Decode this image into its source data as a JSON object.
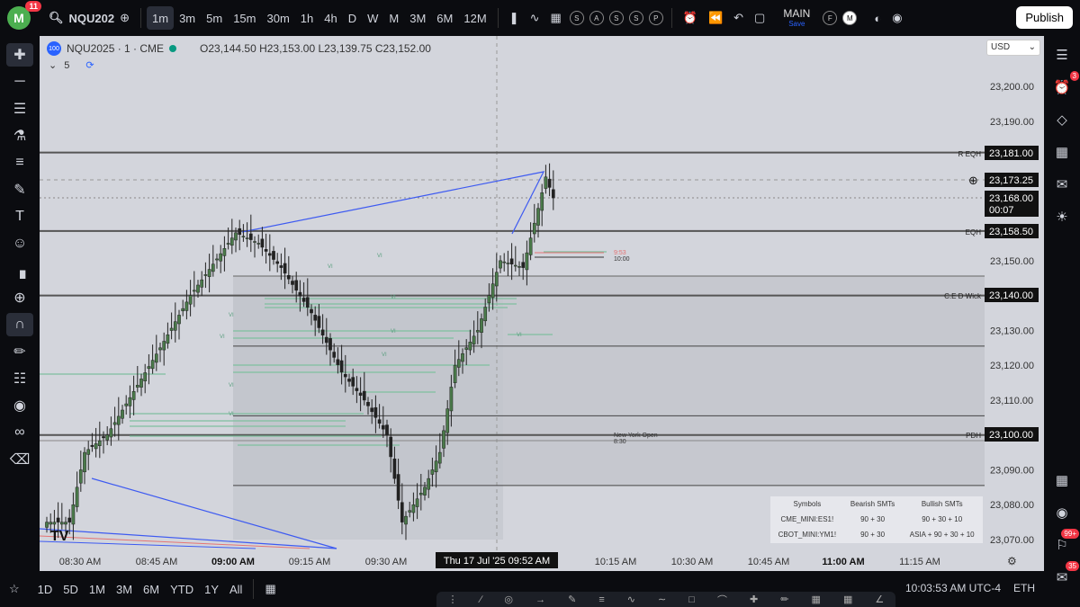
{
  "topbar": {
    "logo_letter": "M",
    "logo_badge": "11",
    "symbol": "NQU202",
    "timeframes": [
      "1m",
      "3m",
      "5m",
      "15m",
      "30m",
      "1h",
      "4h",
      "D",
      "W",
      "M",
      "3M",
      "6M",
      "12M"
    ],
    "active_timeframe": "1m",
    "circle_buttons": [
      "S",
      "A",
      "S",
      "S",
      "P"
    ],
    "layout_name": "MAIN",
    "layout_save": "Save",
    "profile_f": "F",
    "profile_m": "M",
    "publish": "Publish"
  },
  "legend": {
    "badge": "100",
    "title": "NQU2025 · 1 · CME",
    "ohlc": "O23,144.50 H23,153.00 L23,139.75 C23,152.00",
    "indicator_count": "5"
  },
  "currency": "USD",
  "price_axis": {
    "ticks": [
      "23,200.00",
      "23,190.00",
      "23,150.00",
      "23,130.00",
      "23,120.00",
      "23,110.00",
      "23,090.00",
      "23,080.00",
      "23,070.00"
    ],
    "labels": [
      {
        "text": "23,181.00",
        "name": "R EQH"
      },
      {
        "text": "23,173.25",
        "name": ""
      },
      {
        "text": "23,168.00",
        "name": ""
      },
      {
        "text": "00:07",
        "name": ""
      },
      {
        "text": "23,158.50",
        "name": "EQH"
      },
      {
        "text": "23,140.00",
        "name": "C.E D Wick"
      },
      {
        "text": "23,100.00",
        "name": "PDH"
      }
    ]
  },
  "time_axis": {
    "ticks": [
      "08:30 AM",
      "08:45 AM",
      "09:00 AM",
      "09:15 AM",
      "09:30 AM",
      "10:15 AM",
      "10:30 AM",
      "10:45 AM",
      "11:00 AM",
      "11:15 AM"
    ],
    "crosshair": "Thu 17 Jul '25   09:52 AM"
  },
  "annotations": {
    "ny_open": "New York Open",
    "ny_open_time": "8:30",
    "t953": "9:53",
    "t1000": "10:00",
    "vi": "VI"
  },
  "smt_table": {
    "headers": [
      "Symbols",
      "Bearish SMTs",
      "Bullish SMTs"
    ],
    "rows": [
      [
        "CME_MINI:ES1!",
        "90 + 30",
        "90 + 30 + 10"
      ],
      [
        "CBOT_MINI:YM1!",
        "90 + 30",
        "ASIA + 90 + 30 + 10"
      ]
    ]
  },
  "bottombar": {
    "ranges": [
      "1D",
      "5D",
      "1M",
      "3M",
      "6M",
      "YTD",
      "1Y",
      "All"
    ],
    "clock": "10:03:53 AM UTC-4",
    "session": "ETH"
  },
  "right_badges": {
    "alerts": "3",
    "notif": "99+",
    "chat": "35"
  },
  "colors": {
    "bull": "#4a7a4a",
    "bear": "#222222",
    "trend": "#3d5af1",
    "fvg": "#7fbf9f"
  }
}
